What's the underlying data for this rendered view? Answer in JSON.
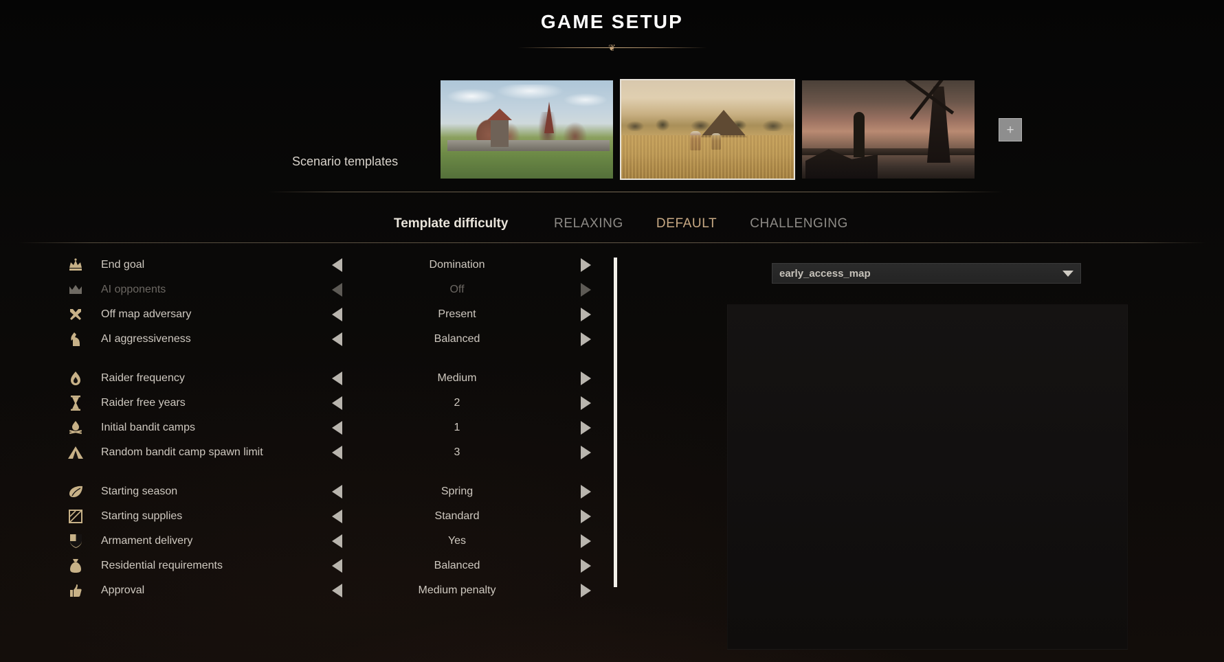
{
  "header": {
    "title": "GAME SETUP",
    "ornament": "❦"
  },
  "templates": {
    "label": "Scenario templates",
    "items": [
      {
        "name": "walled-town-template",
        "selected": false
      },
      {
        "name": "wheat-harvest-template",
        "selected": true
      },
      {
        "name": "dusk-windmill-template",
        "selected": false
      }
    ],
    "add_button_label": "+"
  },
  "difficulty": {
    "label": "Template difficulty",
    "options": [
      {
        "label": "RELAXING",
        "selected": false
      },
      {
        "label": "DEFAULT",
        "selected": true
      },
      {
        "label": "CHALLENGING",
        "selected": false
      }
    ],
    "selected": "DEFAULT",
    "accent_color": "#c8a984"
  },
  "settings": {
    "groups": [
      {
        "rows": [
          {
            "icon": "crown-icon",
            "label": "End goal",
            "value": "Domination",
            "disabled": false
          },
          {
            "icon": "crown-outline-icon",
            "label": "AI opponents",
            "value": "Off",
            "disabled": true
          },
          {
            "icon": "crossed-swords-icon",
            "label": "Off map adversary",
            "value": "Present",
            "disabled": false
          },
          {
            "icon": "knight-chess-icon",
            "label": "AI aggressiveness",
            "value": "Balanced",
            "disabled": false
          }
        ]
      },
      {
        "rows": [
          {
            "icon": "flame-icon",
            "label": "Raider frequency",
            "value": "Medium",
            "disabled": false
          },
          {
            "icon": "hourglass-icon",
            "label": "Raider free years",
            "value": "2",
            "disabled": false
          },
          {
            "icon": "campfire-icon",
            "label": "Initial bandit camps",
            "value": "1",
            "disabled": false
          },
          {
            "icon": "tent-icon",
            "label": "Random bandit camp spawn limit",
            "value": "3",
            "disabled": false
          }
        ]
      },
      {
        "rows": [
          {
            "icon": "leaf-icon",
            "label": "Starting season",
            "value": "Spring",
            "disabled": false
          },
          {
            "icon": "crate-icon",
            "label": "Starting supplies",
            "value": "Standard",
            "disabled": false
          },
          {
            "icon": "shield-icon",
            "label": "Armament delivery",
            "value": "Yes",
            "disabled": false
          },
          {
            "icon": "money-bag-icon",
            "label": "Residential requirements",
            "value": "Balanced",
            "disabled": false
          },
          {
            "icon": "thumbs-up-icon",
            "label": "Approval",
            "value": "Medium penalty",
            "disabled": false
          }
        ]
      }
    ],
    "prev_arrow": "left-arrow-icon",
    "next_arrow": "right-arrow-icon"
  },
  "map": {
    "selected_map": "early_access_map",
    "chevron": "chevron-down-icon"
  }
}
